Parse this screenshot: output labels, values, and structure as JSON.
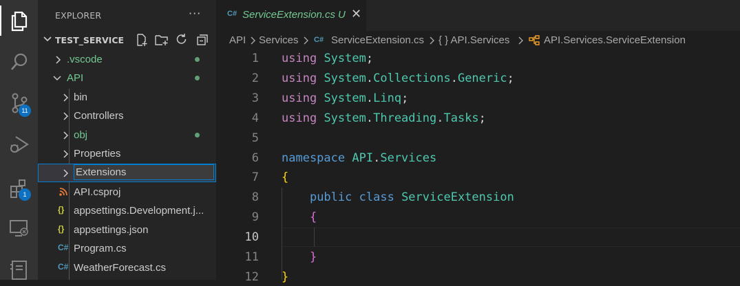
{
  "activity_bar": {
    "items": [
      {
        "name": "explorer",
        "icon": "files-icon"
      },
      {
        "name": "search",
        "icon": "search-icon"
      },
      {
        "name": "source-control",
        "icon": "source-control-icon",
        "badge": "11"
      },
      {
        "name": "run-debug",
        "icon": "debug-icon"
      },
      {
        "name": "extensions",
        "icon": "extensions-icon",
        "badge": "1"
      },
      {
        "name": "remote-explorer",
        "icon": "remote-icon"
      },
      {
        "name": "notebook",
        "icon": "notebook-icon"
      }
    ]
  },
  "sidebar": {
    "title": "EXPLORER",
    "more": "···",
    "section": "TEST_SERVICE",
    "tree": [
      {
        "label": ".vscode",
        "kind": "folder",
        "expanded": false,
        "modified": true
      },
      {
        "label": "API",
        "kind": "folder",
        "expanded": true,
        "modified": true
      },
      {
        "label": "bin",
        "kind": "folder",
        "expanded": false,
        "modified": false
      },
      {
        "label": "Controllers",
        "kind": "folder",
        "expanded": false,
        "modified": false
      },
      {
        "label": "obj",
        "kind": "folder",
        "expanded": false,
        "modified": true
      },
      {
        "label": "Properties",
        "kind": "folder",
        "expanded": false,
        "modified": false
      },
      {
        "label": "Extensions",
        "kind": "rename-input"
      },
      {
        "label": "API.csproj",
        "kind": "file",
        "icon": "rss-icon"
      },
      {
        "label": "appsettings.Development.j...",
        "kind": "file",
        "icon": "json-icon",
        "icon_text": "{}"
      },
      {
        "label": "appsettings.json",
        "kind": "file",
        "icon": "json-icon",
        "icon_text": "{}"
      },
      {
        "label": "Program.cs",
        "kind": "file",
        "icon": "csharp-icon",
        "icon_text": "C#"
      },
      {
        "label": "WeatherForecast.cs",
        "kind": "file",
        "icon": "csharp-icon",
        "icon_text": "C#"
      }
    ]
  },
  "tab": {
    "icon_text": "C#",
    "label": "ServiceExtension.cs",
    "status": "U",
    "close": "✕"
  },
  "breadcrumb": {
    "items": [
      "API",
      "Services",
      "ServiceExtension.cs",
      "{ } API.Services",
      "API.Services.ServiceExtension"
    ],
    "file_icon_text": "C#"
  },
  "editor": {
    "line_numbers": [
      "1",
      "2",
      "3",
      "4",
      "5",
      "6",
      "7",
      "8",
      "9",
      "10",
      "11",
      "12"
    ],
    "active_line": "10",
    "lines": [
      [
        {
          "t": "using",
          "c": "k1"
        },
        {
          "t": " "
        },
        {
          "t": "System",
          "c": "ns"
        },
        {
          "t": ";",
          "c": "pn"
        }
      ],
      [
        {
          "t": "using",
          "c": "k1"
        },
        {
          "t": " "
        },
        {
          "t": "System",
          "c": "ns"
        },
        {
          "t": ".",
          "c": "pn"
        },
        {
          "t": "Collections",
          "c": "ns"
        },
        {
          "t": ".",
          "c": "pn"
        },
        {
          "t": "Generic",
          "c": "ns"
        },
        {
          "t": ";",
          "c": "pn"
        }
      ],
      [
        {
          "t": "using",
          "c": "k1"
        },
        {
          "t": " "
        },
        {
          "t": "System",
          "c": "ns"
        },
        {
          "t": ".",
          "c": "pn"
        },
        {
          "t": "Linq",
          "c": "ns"
        },
        {
          "t": ";",
          "c": "pn"
        }
      ],
      [
        {
          "t": "using",
          "c": "k1"
        },
        {
          "t": " "
        },
        {
          "t": "System",
          "c": "ns"
        },
        {
          "t": ".",
          "c": "pn"
        },
        {
          "t": "Threading",
          "c": "ns"
        },
        {
          "t": ".",
          "c": "pn"
        },
        {
          "t": "Tasks",
          "c": "ns"
        },
        {
          "t": ";",
          "c": "pn"
        }
      ],
      [],
      [
        {
          "t": "namespace",
          "c": "k2"
        },
        {
          "t": " "
        },
        {
          "t": "API",
          "c": "ns"
        },
        {
          "t": ".",
          "c": "pn"
        },
        {
          "t": "Services",
          "c": "ns"
        }
      ],
      [
        {
          "t": "{",
          "c": "br"
        }
      ],
      [
        {
          "t": "    "
        },
        {
          "t": "public",
          "c": "k2"
        },
        {
          "t": " "
        },
        {
          "t": "class",
          "c": "k2"
        },
        {
          "t": " "
        },
        {
          "t": "ServiceExtension",
          "c": "ns"
        }
      ],
      [
        {
          "t": "    "
        },
        {
          "t": "{",
          "c": "br2"
        }
      ],
      [],
      [
        {
          "t": "    "
        },
        {
          "t": "}",
          "c": "br2"
        }
      ],
      [
        {
          "t": "}",
          "c": "br"
        }
      ]
    ]
  },
  "colors": {
    "accent": "#007fd4",
    "badge": "#0e70c0",
    "modified": "#73c991"
  }
}
